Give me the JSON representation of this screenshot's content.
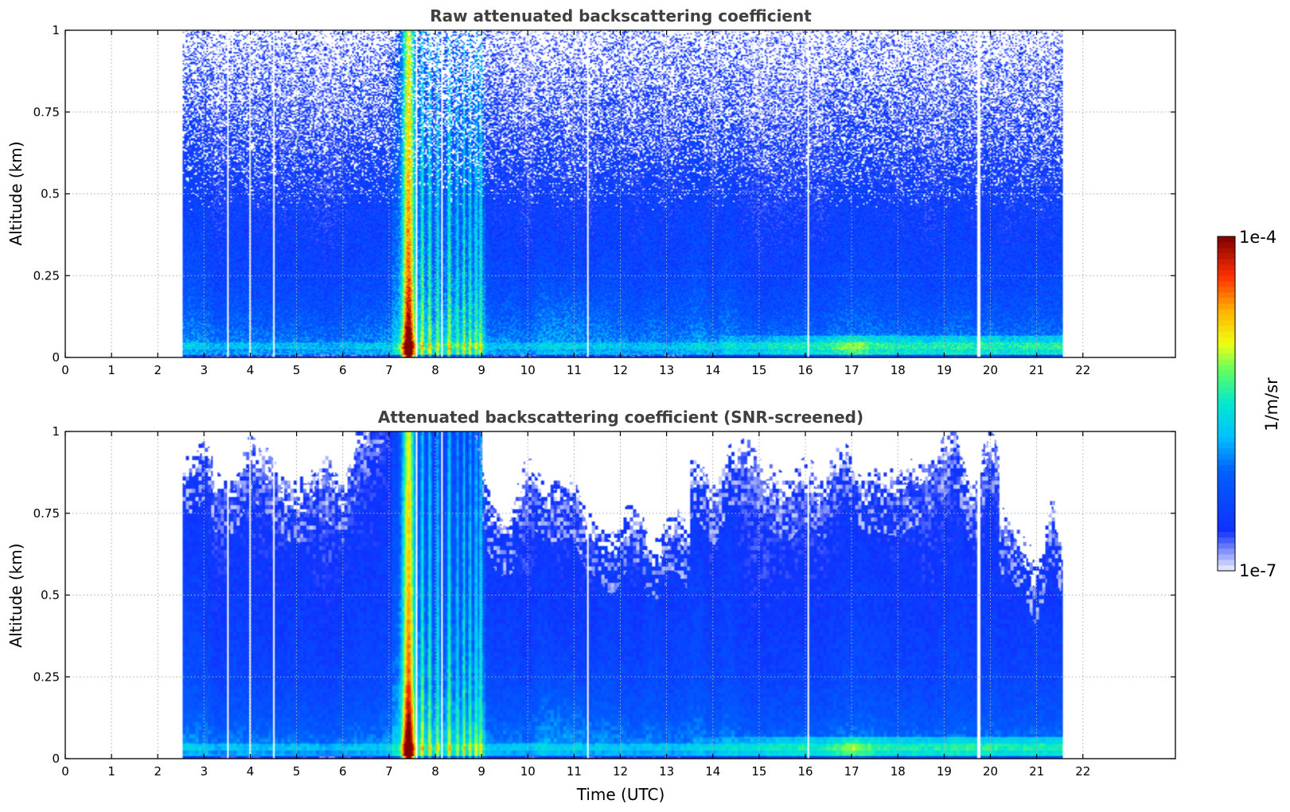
{
  "chart_data": [
    {
      "type": "heatmap",
      "title": "Raw attenuated backscattering coefficient",
      "xlabel": "",
      "ylabel": "Altitude (km)",
      "xlim": [
        0,
        24
      ],
      "ylim": [
        0,
        1
      ],
      "x_ticks": [
        0,
        1,
        2,
        3,
        4,
        5,
        6,
        7,
        8,
        9,
        10,
        11,
        12,
        13,
        14,
        15,
        16,
        17,
        18,
        19,
        20,
        21,
        22
      ],
      "x_tick_labels": [
        "0",
        "1",
        "2",
        "3",
        "4",
        "5",
        "6",
        "7",
        "8",
        "9",
        "10",
        "11",
        "12",
        "13",
        "14",
        "15",
        "16",
        "17",
        "18",
        "19",
        "20",
        "21",
        "22"
      ],
      "y_ticks": [
        0,
        0.25,
        0.5,
        0.75,
        1
      ],
      "y_tick_labels": [
        "0",
        "0.25",
        "0.5",
        "0.75",
        "1"
      ],
      "grid": true,
      "data_range_utc": [
        2.55,
        21.55
      ],
      "data_gaps_utc": [
        3.5,
        4.0,
        4.5,
        7.58,
        8.15,
        11.3,
        16.05,
        19.75
      ],
      "features": [
        {
          "label": "dense aerosol/cloud plume (max near surface)",
          "x_range": [
            7.25,
            7.65
          ],
          "y_range": [
            0,
            1
          ],
          "log_value_peak": -4.2
        },
        {
          "label": "vertical streaks",
          "x_range": [
            7.65,
            9.05
          ],
          "y_range": [
            0,
            1
          ],
          "log_value_peak": -5.3
        },
        {
          "label": "near-surface layer",
          "x_range": [
            13.8,
            21.55
          ],
          "y_range": [
            0,
            0.07
          ],
          "log_value_peak": -5.4
        }
      ],
      "screened": false
    },
    {
      "type": "heatmap",
      "title": "Attenuated backscattering coefficient (SNR-screened)",
      "xlabel": "Time (UTC)",
      "ylabel": "Altitude (km)",
      "xlim": [
        0,
        24
      ],
      "ylim": [
        0,
        1
      ],
      "x_ticks": [
        0,
        1,
        2,
        3,
        4,
        5,
        6,
        7,
        8,
        9,
        10,
        11,
        12,
        13,
        14,
        15,
        16,
        17,
        18,
        19,
        20,
        21,
        22
      ],
      "x_tick_labels": [
        "0",
        "1",
        "2",
        "3",
        "4",
        "5",
        "6",
        "7",
        "8",
        "9",
        "10",
        "11",
        "12",
        "13",
        "14",
        "15",
        "16",
        "17",
        "18",
        "19",
        "20",
        "21",
        "22"
      ],
      "y_ticks": [
        0,
        0.25,
        0.5,
        0.75,
        1
      ],
      "y_tick_labels": [
        "0",
        "0.25",
        "0.5",
        "0.75",
        "1"
      ],
      "grid": true,
      "data_range_utc": [
        2.55,
        21.55
      ],
      "data_gaps_utc": [
        3.5,
        4.0,
        4.5,
        7.58,
        8.15,
        11.3,
        16.05,
        19.75
      ],
      "screened": true
    }
  ],
  "colorbar": {
    "label": "1/m/sr",
    "min_label": "1e-7",
    "max_label": "1e-4",
    "vmin": 1e-07,
    "vmax": 0.0001,
    "scale": "log",
    "colormap": "jet",
    "colors": [
      "#f0f0ff",
      "#1030ff",
      "#0080ff",
      "#00e0e0",
      "#40ff80",
      "#f0ff10",
      "#ffa000",
      "#ff2000",
      "#800000"
    ]
  }
}
